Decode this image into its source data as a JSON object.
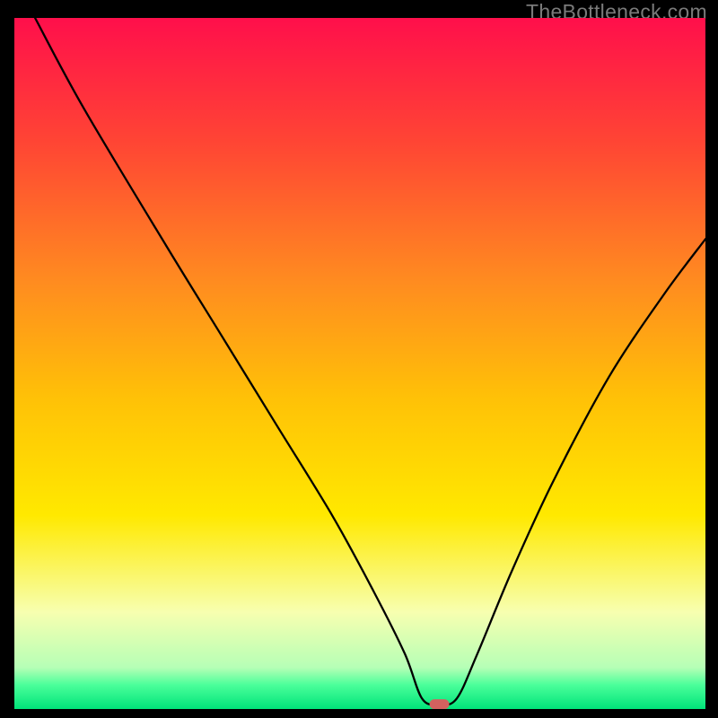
{
  "watermark": "TheBottleneck.com",
  "chart_data": {
    "type": "line",
    "title": "",
    "xlabel": "",
    "ylabel": "",
    "xlim": [
      0,
      100
    ],
    "ylim": [
      0,
      100
    ],
    "grid": false,
    "legend": false,
    "background_gradient": {
      "stops": [
        {
          "pos": 0.0,
          "color": "#ff0f4b"
        },
        {
          "pos": 0.18,
          "color": "#ff4534"
        },
        {
          "pos": 0.38,
          "color": "#ff8b20"
        },
        {
          "pos": 0.55,
          "color": "#ffc107"
        },
        {
          "pos": 0.72,
          "color": "#ffe900"
        },
        {
          "pos": 0.86,
          "color": "#f7ffb0"
        },
        {
          "pos": 0.94,
          "color": "#b6ffb6"
        },
        {
          "pos": 0.965,
          "color": "#4bff9a"
        },
        {
          "pos": 1.0,
          "color": "#00e47a"
        }
      ]
    },
    "series": [
      {
        "name": "bottleneck-curve",
        "x": [
          3,
          10,
          22,
          30,
          38,
          46,
          52,
          56.5,
          59,
          61.5,
          64,
          67,
          72,
          78,
          86,
          94,
          100
        ],
        "y": [
          100,
          87,
          67,
          54,
          41,
          28,
          17,
          8,
          1.5,
          0.7,
          1.5,
          8,
          20,
          33,
          48,
          60,
          68
        ]
      }
    ],
    "markers": [
      {
        "name": "optimal-point",
        "x": 61.5,
        "y": 0.7,
        "color": "#d4615f",
        "shape": "pill"
      }
    ]
  }
}
